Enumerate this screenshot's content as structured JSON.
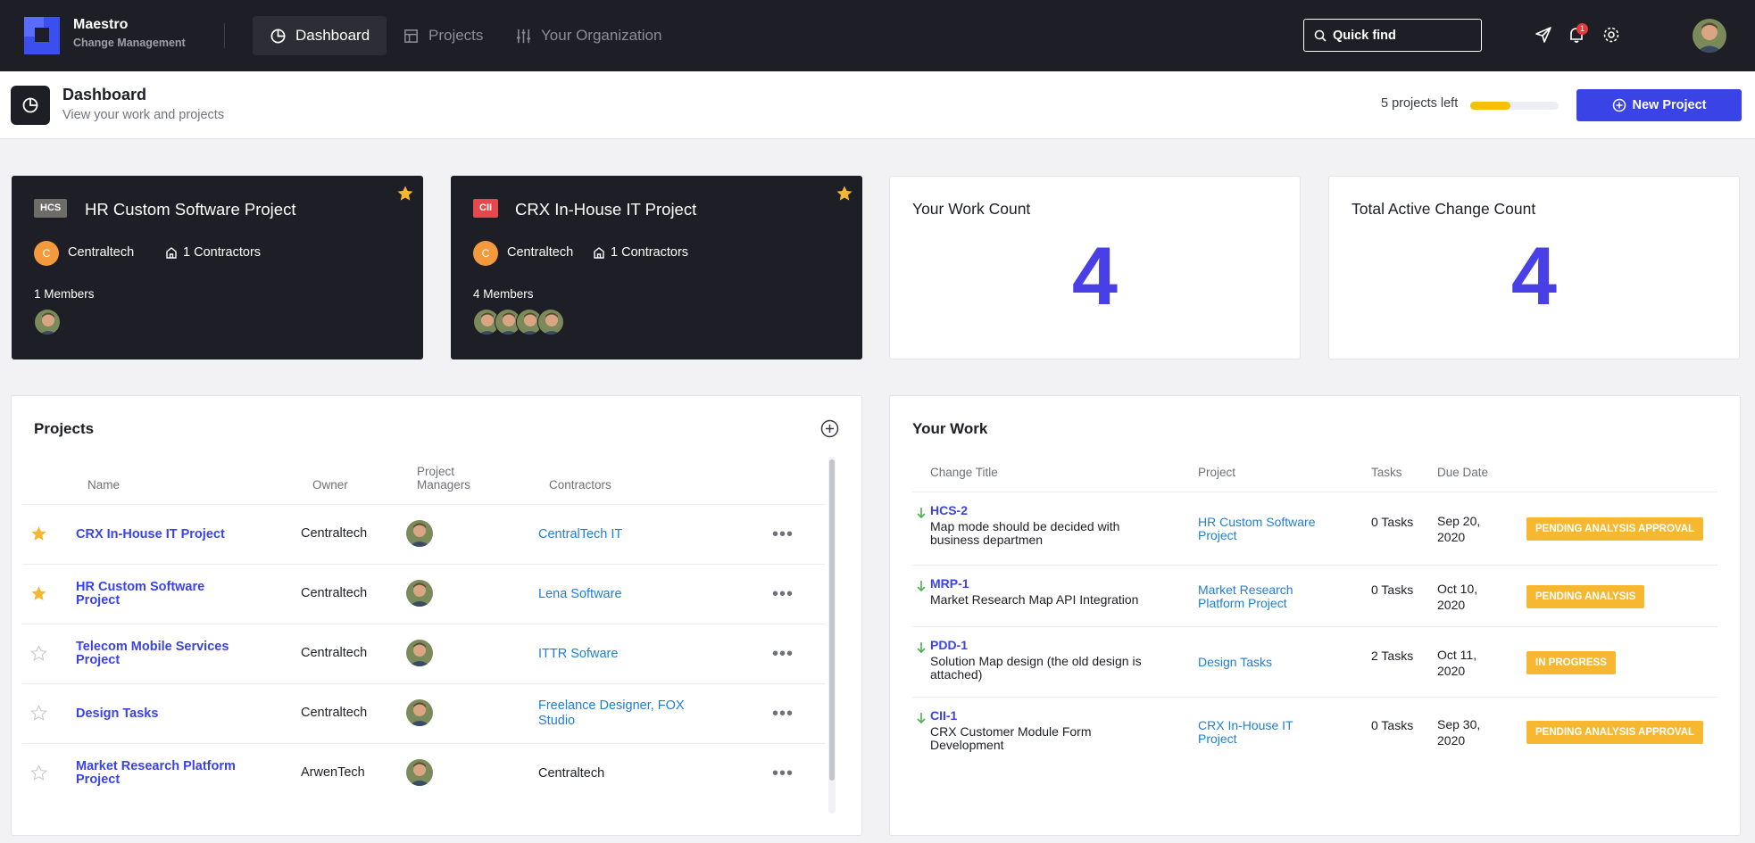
{
  "app": {
    "name": "Maestro",
    "subtitle": "Change Management"
  },
  "nav": [
    {
      "label": "Dashboard",
      "icon": "dashboard-icon",
      "active": true
    },
    {
      "label": "Projects",
      "icon": "table-icon",
      "active": false
    },
    {
      "label": "Your Organization",
      "icon": "sliders-icon",
      "active": false
    }
  ],
  "quick_find": {
    "label": "Quick find"
  },
  "notifications": {
    "count": "1"
  },
  "page": {
    "title": "Dashboard",
    "subtitle": "View your work and projects"
  },
  "plan": {
    "projects_left": "5 projects left",
    "usage_fraction": 0.45
  },
  "new_project": {
    "label": "New Project"
  },
  "project_cards": [
    {
      "code": "HCS",
      "code_color": "#6e6c67",
      "title": "HR Custom Software Project",
      "owner_initial": "C",
      "owner": "Centraltech",
      "contractors": "1 Contractors",
      "members": "1 Members",
      "starred": true
    },
    {
      "code": "CII",
      "code_color": "#e5484d",
      "title": "CRX In-House IT Project",
      "owner_initial": "C",
      "owner": "Centraltech",
      "contractors": "1 Contractors",
      "members": "4 Members",
      "starred": true
    }
  ],
  "count_cards": [
    {
      "label": "Your Work Count",
      "value": "4"
    },
    {
      "label": "Total Active Change Count",
      "value": "4"
    }
  ],
  "projects_panel": {
    "title": "Projects",
    "headers": {
      "name": "Name",
      "owner": "Owner",
      "managers_1": "Project",
      "managers_2": "Managers",
      "contractors": "Contractors"
    },
    "rows": [
      {
        "name": "CRX In-House IT Project",
        "owner": "Centraltech",
        "contractors": "CentralTech IT",
        "starred": true,
        "contractor_link": true
      },
      {
        "name": "HR Custom Software Project",
        "owner": "Centraltech",
        "contractors": "Lena Software",
        "starred": true,
        "contractor_link": true
      },
      {
        "name": "Telecom Mobile Services Project",
        "owner": "Centraltech",
        "contractors": "ITTR Sofware",
        "starred": false,
        "contractor_link": true
      },
      {
        "name": "Design Tasks",
        "owner": "Centraltech",
        "contractors": "Freelance Designer,  FOX Studio",
        "starred": false,
        "contractor_link": true
      },
      {
        "name": "Market Research Platform Project",
        "owner": "ArwenTech",
        "contractors": "Centraltech",
        "starred": false,
        "contractor_link": false
      }
    ]
  },
  "work_panel": {
    "title": "Your Work",
    "headers": {
      "change": "Change Title",
      "project": "Project",
      "tasks": "Tasks",
      "due": "Due Date"
    },
    "rows": [
      {
        "id": "HCS-2",
        "title": "Map mode should be decided with business departmen",
        "project": "HR Custom Software Project",
        "tasks": "0 Tasks",
        "due": "Sep 20, 2020",
        "status": "PENDING ANALYSIS APPROVAL"
      },
      {
        "id": "MRP-1",
        "title": "Market Research Map API Integration",
        "project": "Market Research Platform Project",
        "tasks": "0 Tasks",
        "due": "Oct 10, 2020",
        "status": "PENDING ANALYSIS"
      },
      {
        "id": "PDD-1",
        "title": "Solution Map design (the old design is attached)",
        "project": "Design Tasks",
        "tasks": "2 Tasks",
        "due": "Oct 11, 2020",
        "status": "IN PROGRESS"
      },
      {
        "id": "CII-1",
        "title": "CRX Customer Module Form Development",
        "project": "CRX In-House IT Project",
        "tasks": "0 Tasks",
        "due": "Sep 30, 2020",
        "status": "PENDING ANALYSIS APPROVAL"
      }
    ]
  },
  "colors": {
    "accent": "#3a43e6",
    "star": "#f5b731",
    "status": "#f7b731",
    "link": "#1f7ed6",
    "count": "#4840e6"
  }
}
